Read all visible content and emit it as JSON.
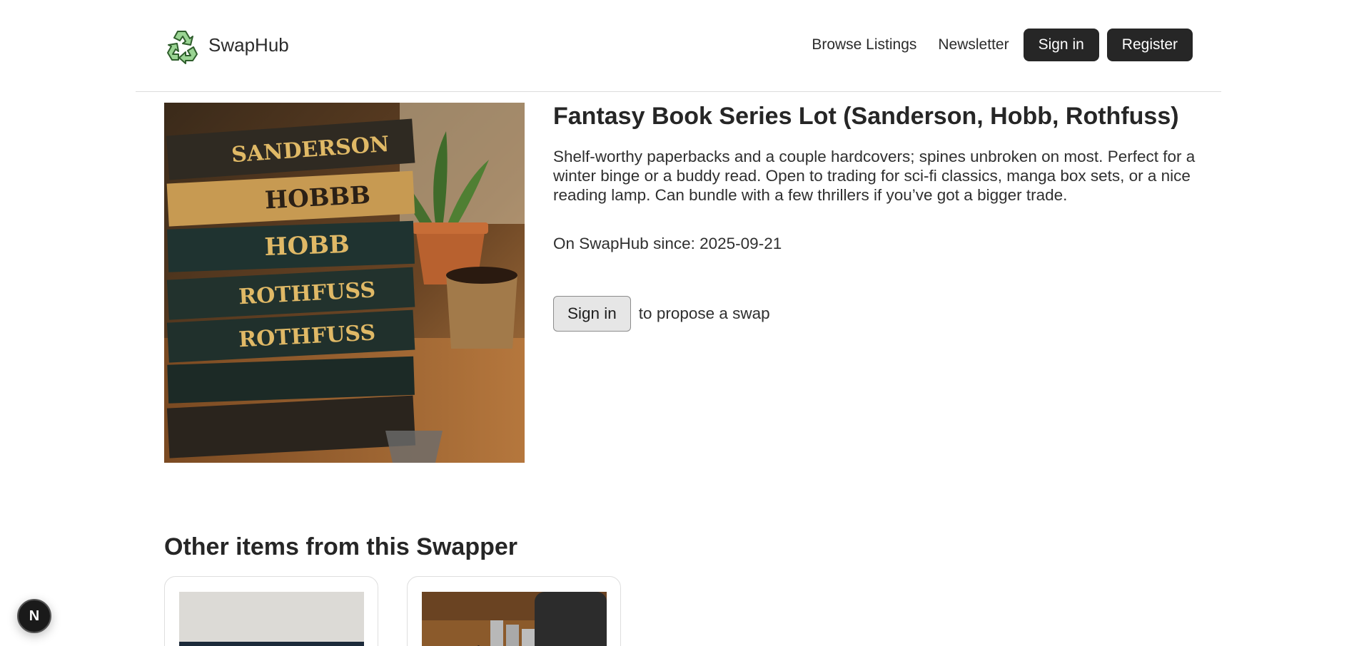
{
  "header": {
    "brand": "SwapHub",
    "nav": {
      "browse": "Browse Listings",
      "newsletter": "Newsletter",
      "sign_in": "Sign in",
      "register": "Register"
    }
  },
  "listing": {
    "title": "Fantasy Book Series Lot (Sanderson, Hobb, Rothfuss)",
    "description": "Shelf-worthy paperbacks and a couple hardcovers; spines unbroken on most. Perfect for a winter binge or a buddy read. Open to trading for sci-fi classics, manga box sets, or a nice reading lamp. Can bundle with a few thrillers if you’ve got a bigger trade.",
    "since_label": "On SwapHub since:",
    "since_date": "2025-09-21",
    "sign_in_button": "Sign in",
    "propose_text": "to propose a swap",
    "image_spines": [
      "SANDERSON",
      "HOBBB",
      "HOBB",
      "ROTHFUSS",
      "ROTHFUSS"
    ]
  },
  "other_items": {
    "title": "Other items from this Swapper"
  },
  "badge": {
    "letter": "N"
  },
  "colors": {
    "primary_button": "#262626",
    "logo_green": "#8fd18a"
  }
}
